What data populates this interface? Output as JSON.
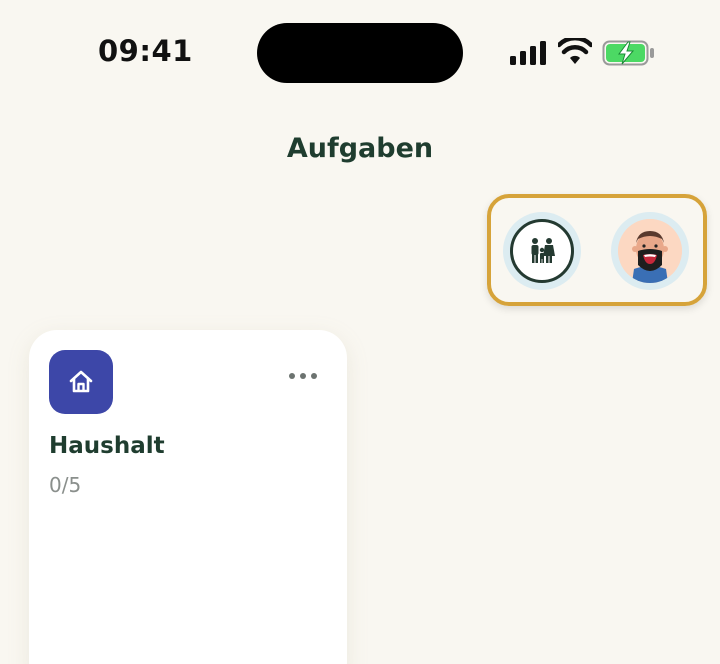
{
  "status_bar": {
    "time": "09:41",
    "icons": [
      "signal-icon",
      "wifi-icon",
      "battery-charging-icon"
    ],
    "battery_color": "#4cd964"
  },
  "header": {
    "title": "Aufgaben"
  },
  "avatars": [
    {
      "name": "family-icon"
    },
    {
      "name": "user-avatar"
    }
  ],
  "highlight_color": "#d6a33a",
  "card": {
    "title": "Haushalt",
    "progress": "0/5",
    "icon": "home-icon",
    "icon_bg": "#3d47a8",
    "more": "more-horizontal-icon"
  }
}
